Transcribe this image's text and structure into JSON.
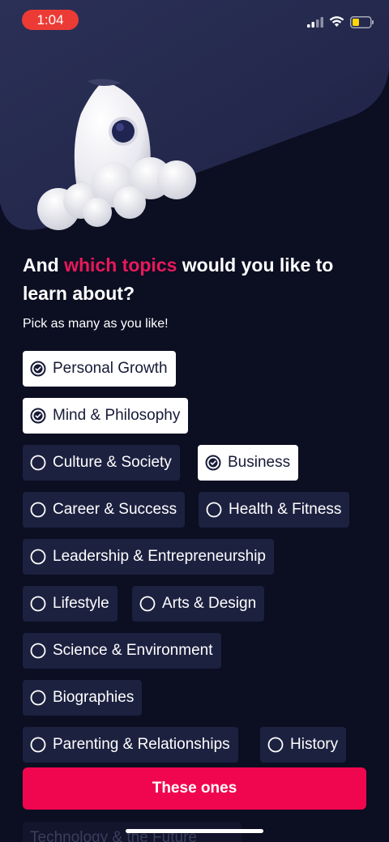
{
  "status": {
    "time": "1:04"
  },
  "heading": {
    "prefix": "And ",
    "accent": "which topics",
    "suffix": " would you like to learn about?"
  },
  "subheading": "Pick as many as you like!",
  "topics": [
    {
      "label": "Personal Growth",
      "selected": true
    },
    {
      "label": "Mind & Philosophy",
      "selected": true
    },
    {
      "label": "Culture & Society",
      "selected": false
    },
    {
      "label": "Business",
      "selected": true
    },
    {
      "label": "Career & Success",
      "selected": false
    },
    {
      "label": "Health & Fitness",
      "selected": false
    },
    {
      "label": "Leadership & Entrepreneurship",
      "selected": false
    },
    {
      "label": "Lifestyle",
      "selected": false
    },
    {
      "label": "Arts & Design",
      "selected": false
    },
    {
      "label": "Science & Environment",
      "selected": false
    },
    {
      "label": "Biographies",
      "selected": false
    },
    {
      "label": "Parenting & Relationships",
      "selected": false
    },
    {
      "label": "History",
      "selected": false
    },
    {
      "label": "Technology & the Future",
      "selected": false
    }
  ],
  "cta_label": "These ones",
  "colors": {
    "background": "#0c0e22",
    "chip": "#1d2140",
    "accent": "#e8195a",
    "button": "#f0064f"
  }
}
